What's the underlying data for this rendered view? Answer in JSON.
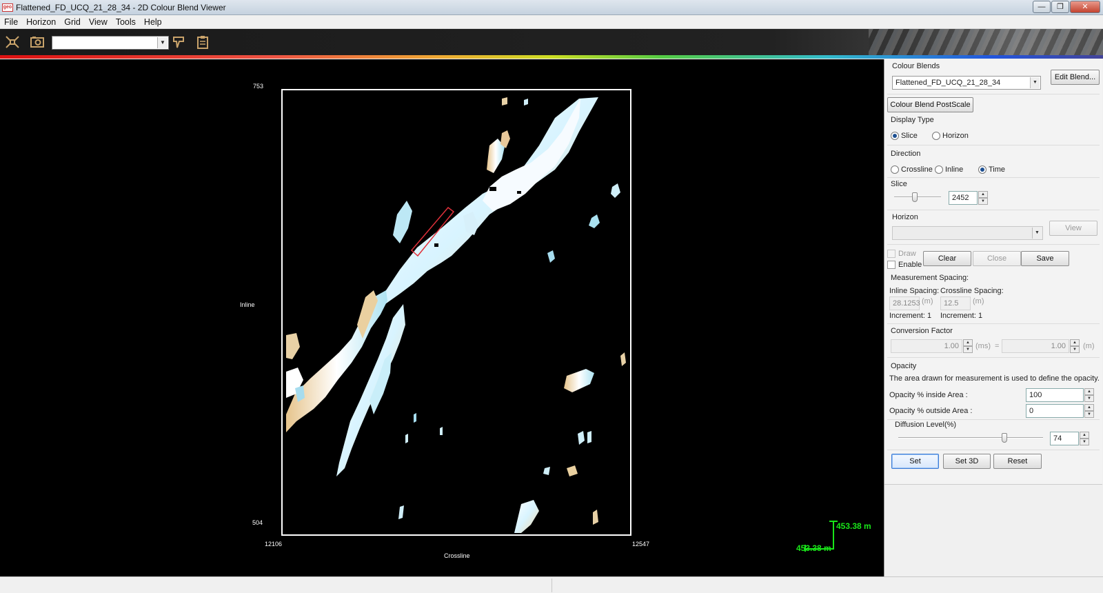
{
  "window": {
    "title": "Flattened_FD_UCQ_21_28_34 - 2D Colour Blend Viewer",
    "logo_text": "geo",
    "controls": {
      "minimize": "—",
      "maximize": "❐",
      "close": "✕"
    }
  },
  "menu": [
    "File",
    "Horizon",
    "Grid",
    "View",
    "Tools",
    "Help"
  ],
  "toolbar": {
    "icons": [
      "fit-view-icon",
      "camera-icon",
      "horizon-marker-icon",
      "clipboard-icon"
    ],
    "combo_value": ""
  },
  "plot": {
    "y_axis_label": "Inline",
    "x_axis_label": "Crossline",
    "y_top": "753",
    "y_bottom": "504",
    "x_left": "12106",
    "x_right": "12547",
    "scale_vertical": "453.38 m",
    "scale_horizontal": "453.38 m",
    "colors": {
      "background": "#000000",
      "frame": "#ffffff",
      "scale": "#19e619",
      "measure_area": "#e0303a"
    }
  },
  "panel": {
    "colour_blends_label": "Colour Blends",
    "colour_blend_value": "Flattened_FD_UCQ_21_28_34",
    "edit_blend_button": "Edit Blend...",
    "postscale_button": "Colour Blend PostScale",
    "display_type_label": "Display Type",
    "display_type_options": [
      {
        "label": "Slice",
        "selected": true
      },
      {
        "label": "Horizon",
        "selected": false
      }
    ],
    "direction_label": "Direction",
    "direction_options": [
      {
        "label": "Crossline",
        "selected": false
      },
      {
        "label": "Inline",
        "selected": false
      },
      {
        "label": "Time",
        "selected": true
      }
    ],
    "slice_label": "Slice",
    "slice_value": "2452",
    "horizon_label": "Horizon",
    "horizon_value": "",
    "view_button": "View",
    "draw_label": "Draw",
    "enable_label": "Enable",
    "clear_button": "Clear",
    "close_button": "Close",
    "save_button": "Save",
    "measurement_spacing_label": "Measurement Spacing:",
    "inline_spacing_label": "Inline Spacing:",
    "crossline_spacing_label": "Crossline Spacing:",
    "inline_spacing_value": "28.1253",
    "crossline_spacing_value": "12.5",
    "unit_m": "(m)",
    "inline_increment": "Increment: 1",
    "crossline_increment": "Increment: 1",
    "conversion_factor_label": "Conversion Factor",
    "conversion_left_value": "1.00",
    "conversion_left_unit": "(ms)",
    "equals": "=",
    "conversion_right_value": "1.00",
    "conversion_right_unit": "(m)",
    "opacity_label": "Opacity",
    "opacity_description": "The area drawn for measurement is used to define the opacity.",
    "opacity_inside_label": "Opacity % inside Area :",
    "opacity_inside_value": "100",
    "opacity_outside_label": "Opacity % outside Area :",
    "opacity_outside_value": "0",
    "diffusion_label": "Diffusion Level(%)",
    "diffusion_value": "74",
    "set_button": "Set",
    "set3d_button": "Set 3D",
    "reset_button": "Reset"
  }
}
